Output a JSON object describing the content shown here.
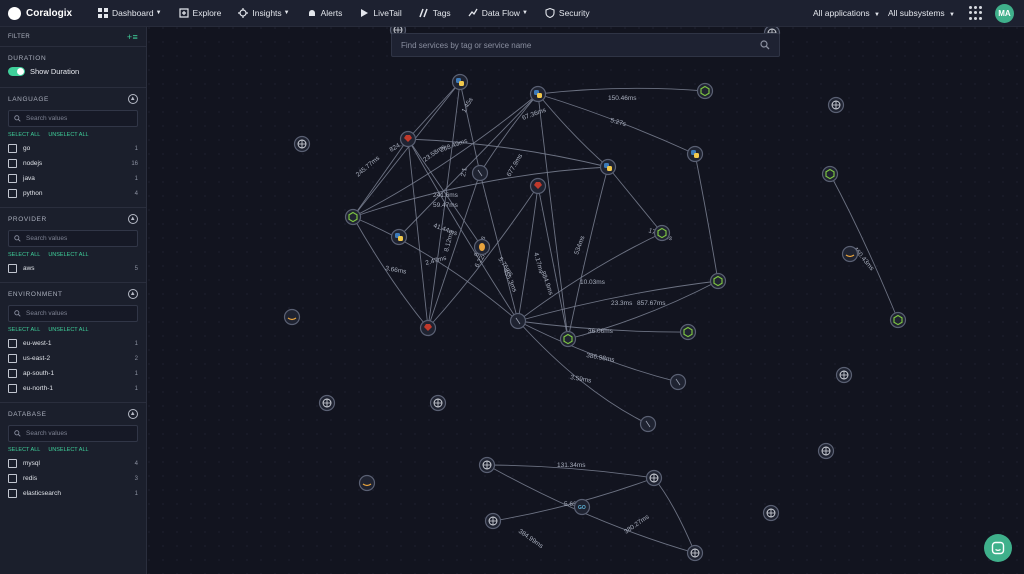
{
  "topbar": {
    "logo": "Coralogix",
    "nav": [
      {
        "label": "Dashboard",
        "icon": "dashboard-icon",
        "caret": true
      },
      {
        "label": "Explore",
        "icon": "explore-icon",
        "caret": false
      },
      {
        "label": "Insights",
        "icon": "insights-icon",
        "caret": true
      },
      {
        "label": "Alerts",
        "icon": "bell-icon",
        "caret": false
      },
      {
        "label": "LiveTail",
        "icon": "play-icon",
        "caret": false
      },
      {
        "label": "Tags",
        "icon": "tags-icon",
        "caret": false
      },
      {
        "label": "Data Flow",
        "icon": "data-flow-icon",
        "caret": true
      },
      {
        "label": "Security",
        "icon": "shield-icon",
        "caret": false
      }
    ],
    "applications": "All applications",
    "subsystems": "All subsystems",
    "avatar": "MA"
  },
  "sidebar": {
    "filter_label": "FILTER",
    "duration": {
      "title": "DURATION",
      "toggle_label": "Show Duration",
      "toggle_on": true
    },
    "select_all": "SELECT ALL",
    "unselect_all": "UNSELECT ALL",
    "search_placeholder": "Search values",
    "sections": [
      {
        "title": "LANGUAGE",
        "options": [
          {
            "label": "go",
            "count": "1"
          },
          {
            "label": "nodejs",
            "count": "16"
          },
          {
            "label": "java",
            "count": "1"
          },
          {
            "label": "python",
            "count": "4"
          }
        ]
      },
      {
        "title": "PROVIDER",
        "options": [
          {
            "label": "aws",
            "count": "5"
          }
        ]
      },
      {
        "title": "ENVIRONMENT",
        "options": [
          {
            "label": "eu-west-1",
            "count": "1"
          },
          {
            "label": "us-east-2",
            "count": "2"
          },
          {
            "label": "ap-south-1",
            "count": "1"
          },
          {
            "label": "eu-north-1",
            "count": "1"
          }
        ]
      },
      {
        "title": "DATABASE",
        "options": [
          {
            "label": "mysql",
            "count": "4"
          },
          {
            "label": "redis",
            "count": "3"
          },
          {
            "label": "elasticsearch",
            "count": "1"
          }
        ]
      }
    ]
  },
  "map": {
    "search_placeholder": "Find services by tag or service name",
    "colors": {
      "python_blue": "#3d7ab8",
      "python_yellow": "#f2c94c",
      "node_green": "#7cc242",
      "ruby_red": "#c0392b",
      "aws_orange": "#e8a33d",
      "edge": "#7d8394"
    },
    "edge_labels": [
      "150.46ms",
      "1.45s",
      "67.36ms",
      "5.27s",
      "824.1ms",
      "288.49ms",
      "23.58ms",
      "2.1",
      "677.9ms",
      "245.77ms",
      "241.6ms",
      "59.47ms",
      "8.12ms",
      "41.44ms",
      "3.66ms",
      "2.47ms",
      "8.03ms",
      "6.22ms",
      "4.17ms",
      "5.76ms",
      "455.3ms",
      "884.9ms",
      "534ms",
      "10.03ms",
      "23.3ms",
      "857.67ms",
      "17.52ms",
      "36.06ms",
      "386.98ms",
      "3.59ms",
      "460.43ms",
      "131.34ms",
      "5.63",
      "384.99ms",
      "380.27ms"
    ]
  },
  "chat_icon": "chat-icon"
}
